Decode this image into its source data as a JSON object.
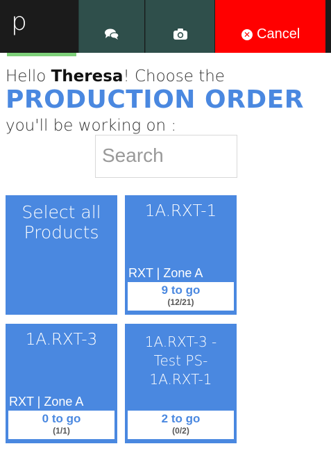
{
  "header": {
    "logo": "p",
    "buttons": [
      {
        "icon": "chat-bubbles-icon"
      },
      {
        "icon": "camera-icon"
      }
    ],
    "cancel_label": "Cancel",
    "cancel_icon": "x-circle-icon",
    "colors": {
      "bar": "#1b1b1b",
      "buttons": "#2f4f4b",
      "cancel": "#ff0000",
      "accent": "#7ed07a"
    }
  },
  "intro": {
    "greeting": "Hello ",
    "user": "Theresa",
    "prompt": "! Choose the",
    "emphasis": "PRODUCTION ORDER",
    "suffix": " you'll be working on :"
  },
  "search": {
    "placeholder": "Search"
  },
  "orders": [
    {
      "title": "Select all Products",
      "zone": "",
      "togo": "",
      "count": ""
    },
    {
      "title": "1A.RXT-1",
      "zone": "RXT | Zone A",
      "togo": "9 to go",
      "count": "(12/21)"
    },
    {
      "title": "1A.RXT-3",
      "zone": "RXT | Zone A",
      "togo": "0 to go",
      "count": "(1/1)"
    },
    {
      "title": "1A.RXT-3 - Test PS-1A.RXT-1",
      "zone": "",
      "togo": "2 to go",
      "count": "(0/2)"
    }
  ],
  "colors": {
    "card": "#4a88e0",
    "emphasis": "#4a88e0"
  }
}
